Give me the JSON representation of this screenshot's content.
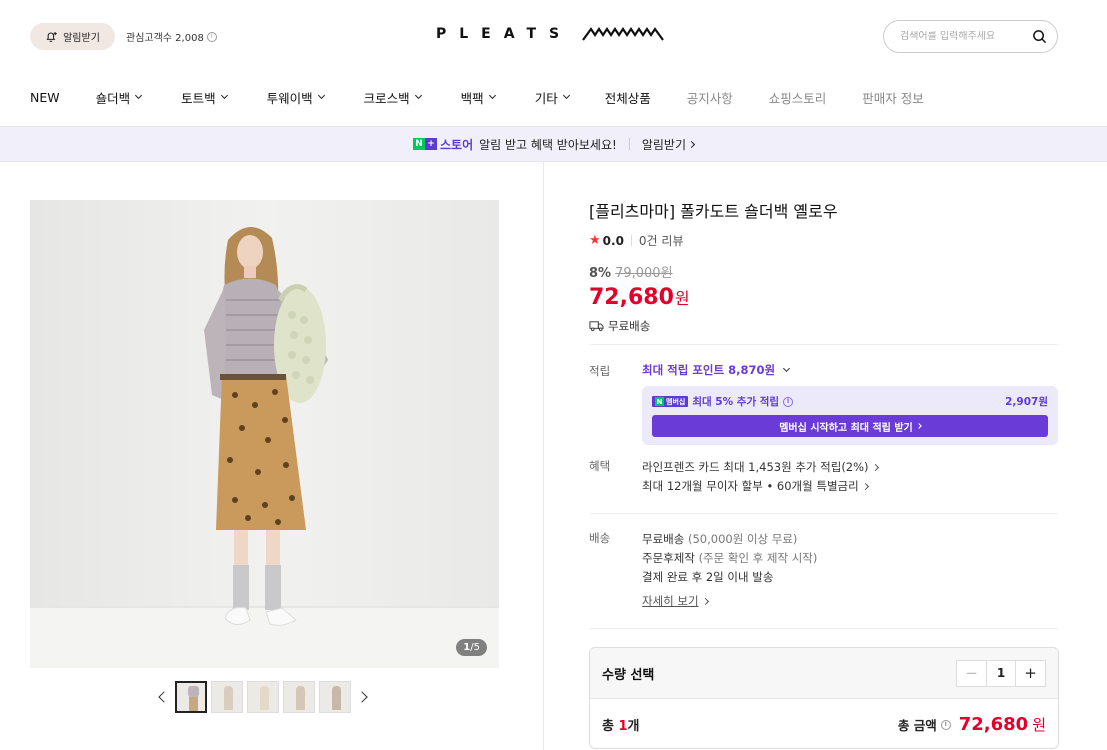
{
  "header": {
    "alarm_label": "알림받기",
    "fan_count_label": "관심고객수 2,008",
    "logo_text": "PLEATS",
    "search_placeholder": "검색어를 입력해주세요"
  },
  "nav": {
    "items": [
      {
        "label": "NEW",
        "dropdown": false,
        "muted": false
      },
      {
        "label": "숄더백",
        "dropdown": true,
        "muted": false
      },
      {
        "label": "토트백",
        "dropdown": true,
        "muted": false
      },
      {
        "label": "투웨이백",
        "dropdown": true,
        "muted": false
      },
      {
        "label": "크로스백",
        "dropdown": true,
        "muted": false
      },
      {
        "label": "백팩",
        "dropdown": true,
        "muted": false
      },
      {
        "label": "기타",
        "dropdown": true,
        "muted": false
      },
      {
        "label": "전체상품",
        "dropdown": false,
        "muted": false
      },
      {
        "label": "공지사항",
        "dropdown": false,
        "muted": true
      },
      {
        "label": "쇼핑스토리",
        "dropdown": false,
        "muted": true
      },
      {
        "label": "판매자 정보",
        "dropdown": false,
        "muted": true
      }
    ]
  },
  "banner": {
    "store_label": "스토어",
    "message": "알림 받고 혜택 받아보세요!",
    "alarm_label": "알림받기"
  },
  "gallery": {
    "counter_current": "1",
    "counter_total": "/5",
    "thumb_count": 5
  },
  "product": {
    "title": "[플리츠마마] 폴카도트 숄더백 옐로우",
    "rating": "0.0",
    "reviews": "0건 리뷰",
    "discount_pct": "8%",
    "original_price": "79,000원",
    "price": "72,680",
    "price_unit": "원",
    "shipping_summary": "무료배송"
  },
  "points": {
    "label": "적립",
    "max_points": "최대 적립 포인트 8,870원",
    "membership_badge": "멤버십",
    "extra_label": "최대 5% 추가 적립",
    "extra_amount": "2,907원",
    "cta": "멤버십 시작하고 최대 적립 받기"
  },
  "benefits": {
    "label": "혜택",
    "line1": "라인프렌즈 카드 최대 1,453원 추가 적립(2%)",
    "line2": "최대 12개월 무이자 할부 • 60개월 특별금리"
  },
  "delivery": {
    "label": "배송",
    "line1_main": "무료배송",
    "line1_sub": "(50,000원 이상 무료)",
    "line2_main": "주문후제작",
    "line2_sub": "(주문 확인 후 제작 시작)",
    "line3": "결제 완료 후 2일 이내 발송",
    "detail_link": "자세히 보기"
  },
  "quantity": {
    "title": "수량 선택",
    "minus": "−",
    "value": "1",
    "plus": "+",
    "total_prefix": "총 ",
    "total_count": "1",
    "total_suffix": "개",
    "sum_label": "총 금액",
    "sum_value": "72,680",
    "sum_unit": "원"
  },
  "colors": {
    "accent_red": "#e4002b",
    "membership_purple": "#6a3bd6",
    "naver_green": "#03c75a"
  }
}
